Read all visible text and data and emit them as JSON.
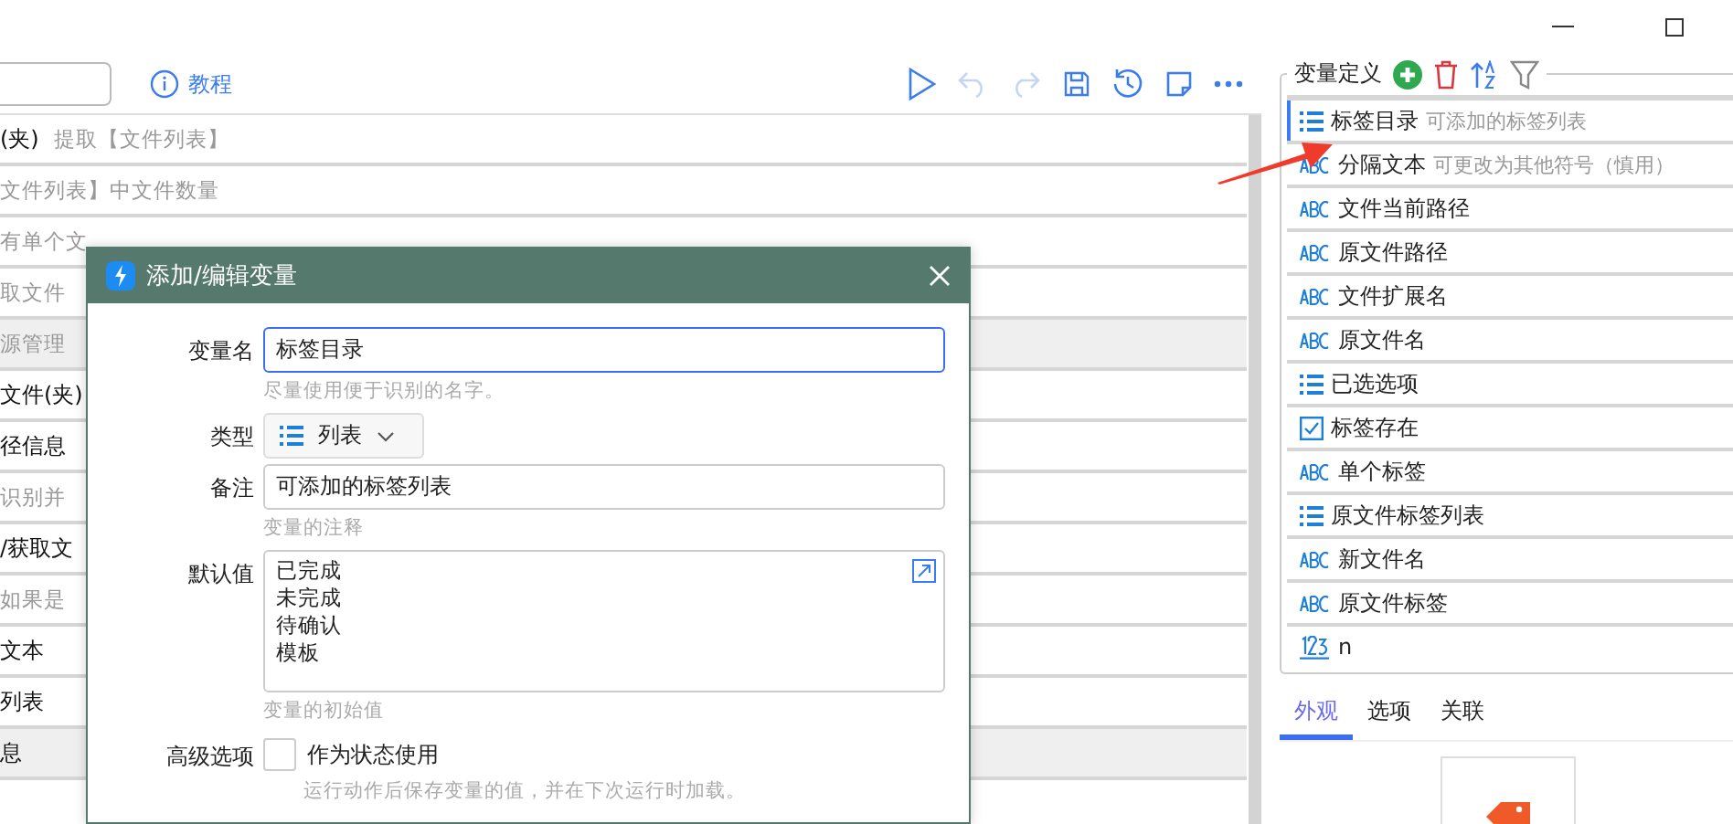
{
  "toolbar": {
    "tutorial_link": "教程"
  },
  "steps": [
    {
      "title": "(夹)",
      "note": "提取【文件列表】",
      "shaded": false
    },
    {
      "note": "文件列表】中文件数量",
      "shaded": false
    },
    {
      "note": "有单个文",
      "shaded": false
    },
    {
      "note": "取文件",
      "shaded": false
    },
    {
      "note": "源管理",
      "shaded": true
    },
    {
      "title": "文件(夹)",
      "shaded": false
    },
    {
      "title": "径信息",
      "shaded": false
    },
    {
      "note": "识别并",
      "shaded": false
    },
    {
      "title": "/获取文",
      "shaded": false
    },
    {
      "note": "如果是",
      "shaded": false
    },
    {
      "title": "文本",
      "shaded": false
    },
    {
      "title": "列表",
      "shaded": false
    },
    {
      "title": "息",
      "shaded": true
    }
  ],
  "dialog": {
    "title": "添加/编辑变量",
    "name_label": "变量名",
    "name_value": "标签目录",
    "name_hint": "尽量使用便于识别的名字。",
    "type_label": "类型",
    "type_value": "列表",
    "note_label": "备注",
    "note_value": "可添加的标签列表",
    "note_hint": "变量的注释",
    "default_label": "默认值",
    "default_lines": [
      "已完成",
      "未完成",
      "待确认",
      "模板"
    ],
    "default_hint": "变量的初始值",
    "advanced_label": "高级选项",
    "state_checkbox": {
      "label": "作为状态使用",
      "checked": false
    },
    "advanced_hint": "运行动作后保存变量的值，并在下次运行时加载。"
  },
  "variables": {
    "title": "变量定义",
    "items": [
      {
        "kind": "list",
        "name": "标签目录",
        "note": "可添加的标签列表",
        "selected": true
      },
      {
        "kind": "text",
        "name": "分隔文本",
        "note": "可更改为其他符号（慎用）",
        "selected": false
      },
      {
        "kind": "text",
        "name": "文件当前路径",
        "selected": false
      },
      {
        "kind": "text",
        "name": "原文件路径",
        "selected": false
      },
      {
        "kind": "text",
        "name": "文件扩展名",
        "selected": false
      },
      {
        "kind": "text",
        "name": "原文件名",
        "selected": false
      },
      {
        "kind": "list",
        "name": "已选选项",
        "selected": false
      },
      {
        "kind": "bool",
        "name": "标签存在",
        "selected": false
      },
      {
        "kind": "text",
        "name": "单个标签",
        "selected": false
      },
      {
        "kind": "list",
        "name": "原文件标签列表",
        "selected": false
      },
      {
        "kind": "text",
        "name": "新文件名",
        "selected": false
      },
      {
        "kind": "text",
        "name": "原文件标签",
        "selected": false
      },
      {
        "kind": "number",
        "name": "n",
        "selected": false
      }
    ]
  },
  "tabs": [
    {
      "label": "外观",
      "selected": true
    },
    {
      "label": "选项",
      "selected": false
    },
    {
      "label": "关联",
      "selected": false
    }
  ]
}
